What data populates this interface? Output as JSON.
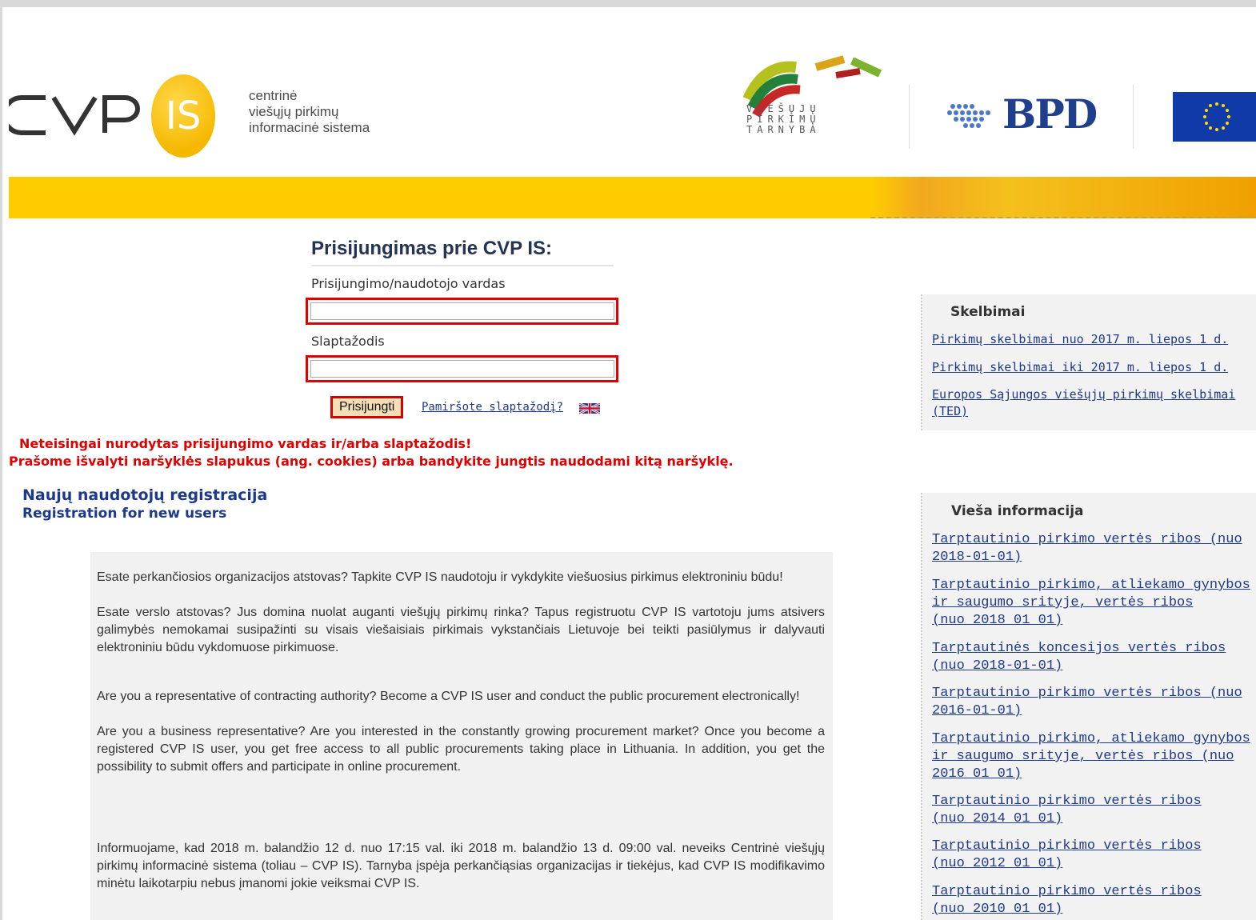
{
  "header": {
    "logo_cvp": "CVP",
    "logo_is": "IS",
    "logo_text": [
      "centrinė",
      "viešųjų pirkimų",
      "informacinė sistema"
    ],
    "vpt_text": [
      "VIEŠŲJŲ",
      "PIRKIMŲ",
      "TARNYBA"
    ],
    "bpd_text": "BPD",
    "brand_yellow": "#ffcc00"
  },
  "login": {
    "title": "Prisijungimas prie CVP IS:",
    "username_label": "Prisijungimo/naudotojo vardas",
    "username_value": "",
    "password_label": "Slaptažodis",
    "password_value": "",
    "submit_label": "Prisijungti",
    "forgot_label": "Pamiršote slaptažodį?",
    "language_icon": "uk-flag-icon"
  },
  "errors": {
    "line1": "Neteisingai nurodytas prisijungimo vardas ir/arba slaptažodis!",
    "line2": "Prašome išvalyti naršyklės slapukus (ang. cookies) arba bandykite jungtis naudodami kitą naršyklę."
  },
  "registration": {
    "title": "Naujų naudotojų registracija",
    "subtitle": "Registration for new users"
  },
  "info": {
    "p1": "Esate perkančiosios organizacijos atstovas? Tapkite CVP IS naudotoju ir vykdykite viešuosius pirkimus elektroniniu būdu!",
    "p2": "Esate verslo atstovas? Jus domina nuolat auganti viešųjų pirkimų rinka? Tapus registruotu CVP IS vartotoju jums atsivers galimybės nemokamai susipažinti su visais viešaisiais pirkimais vykstančiais Lietuvoje bei teikti pasiūlymus ir dalyvauti elektroniniu būdu vykdomuose pirkimuose.",
    "p3": "Are you a representative of contracting authority? Become a CVP IS user and conduct the public procurement electronically!",
    "p4": "Are you a business representative? Are you interested in the constantly growing procurement market? Once you become a registered CVP IS user, you get free access to all public procurements taking place in Lithuania. In addition, you get the possibility to submit offers and participate in online procurement.",
    "p5": "Informuojame, kad 2018 m. balandžio 12 d. nuo 17:15 val. iki 2018 m. balandžio 13 d. 09:00 val. neveiks Centrinė viešųjų pirkimų informacinė sistema (toliau – CVP IS). Tarnyba įspėja perkančiąsias organizacijas ir tiekėjus, kad CVP IS modifikavimo minėtu laikotarpiu nebus įmanomi jokie veiksmai CVP IS."
  },
  "sidebar": {
    "notices_title": "Skelbimai",
    "notices": [
      "Pirkimų skelbimai nuo 2017 m. liepos 1 d.",
      "Pirkimų skelbimai iki 2017 m. liepos 1 d.",
      "Europos Sąjungos viešųjų pirkimų skelbimai (TED)"
    ],
    "public_title": "Vieša informacija",
    "public_links": [
      "Tarptautinio pirkimo vertės ribos (nuo 2018-01-01)",
      "Tarptautinio pirkimo, atliekamo gynybos ir saugumo srityje, vertės ribos\n(nuo 2018 01 01)",
      "Tarptautinės koncesijos vertės ribos (nuo 2018-01-01)",
      "Tarptautinio pirkimo vertės ribos (nuo 2016-01-01)",
      "Tarptautinio pirkimo, atliekamo gynybos ir saugumo srityje, vertės ribos (nuo 2016 01 01)",
      "Tarptautinio pirkimo vertės ribos\n(nuo 2014 01 01)",
      "Tarptautinio pirkimo vertės ribos\n(nuo 2012 01 01)",
      "Tarptautinio pirkimo vertės ribos\n(nuo 2010 01 01)"
    ]
  }
}
